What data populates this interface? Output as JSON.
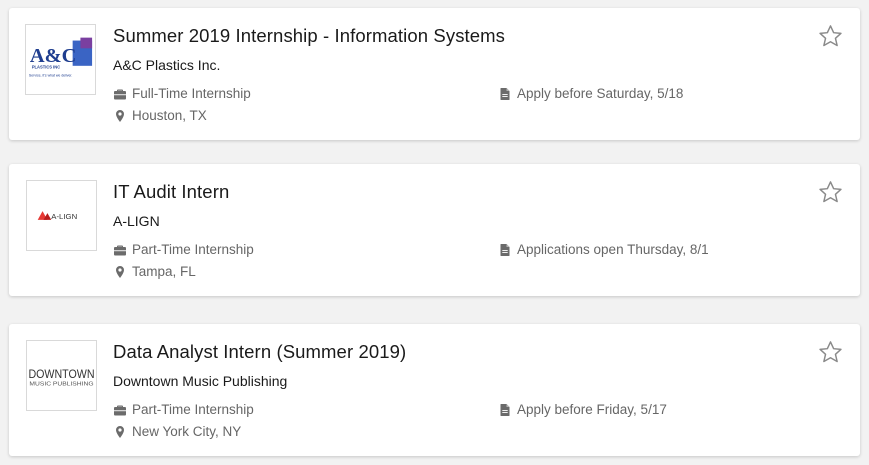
{
  "colors": {
    "page_bg": "#f2f2f2",
    "card_bg": "#ffffff",
    "meta_text": "#666666",
    "icon": "#6b6b6b",
    "star_outline": "#8a8a8a",
    "aclign_red": "#e53935",
    "ac_blue": "#1f3e8f"
  },
  "jobs": [
    {
      "title": "Summer 2019 Internship - Information Systems",
      "company": "A&C Plastics Inc.",
      "type": "Full-Time Internship",
      "location": "Houston, TX",
      "deadline": "Apply before Saturday, 5/18",
      "logo": {
        "kind": "ac-plastics",
        "wordmark": "A&C",
        "subline": "PLASTICS INC",
        "tagline": "Service, it's what we deliver."
      },
      "icons": {
        "type": "briefcase-icon",
        "location": "map-pin-icon",
        "deadline": "document-icon",
        "favorite": "star-outline-icon"
      }
    },
    {
      "title": "IT Audit Intern",
      "company": "A-LIGN",
      "type": "Part-Time Internship",
      "location": "Tampa, FL",
      "deadline": "Applications open Thursday, 8/1",
      "logo": {
        "kind": "a-lign",
        "wordmark": "A-LIGN"
      },
      "icons": {
        "type": "briefcase-icon",
        "location": "map-pin-icon",
        "deadline": "document-icon",
        "favorite": "star-outline-icon"
      }
    },
    {
      "title": "Data Analyst Intern (Summer 2019)",
      "company": "Downtown Music Publishing",
      "type": "Part-Time Internship",
      "location": "New York City, NY",
      "deadline": "Apply before Friday, 5/17",
      "logo": {
        "kind": "downtown",
        "wordmark": "DOWNTOWN",
        "subline": "MUSIC PUBLISHING"
      },
      "icons": {
        "type": "briefcase-icon",
        "location": "map-pin-icon",
        "deadline": "document-icon",
        "favorite": "star-outline-icon"
      }
    }
  ]
}
